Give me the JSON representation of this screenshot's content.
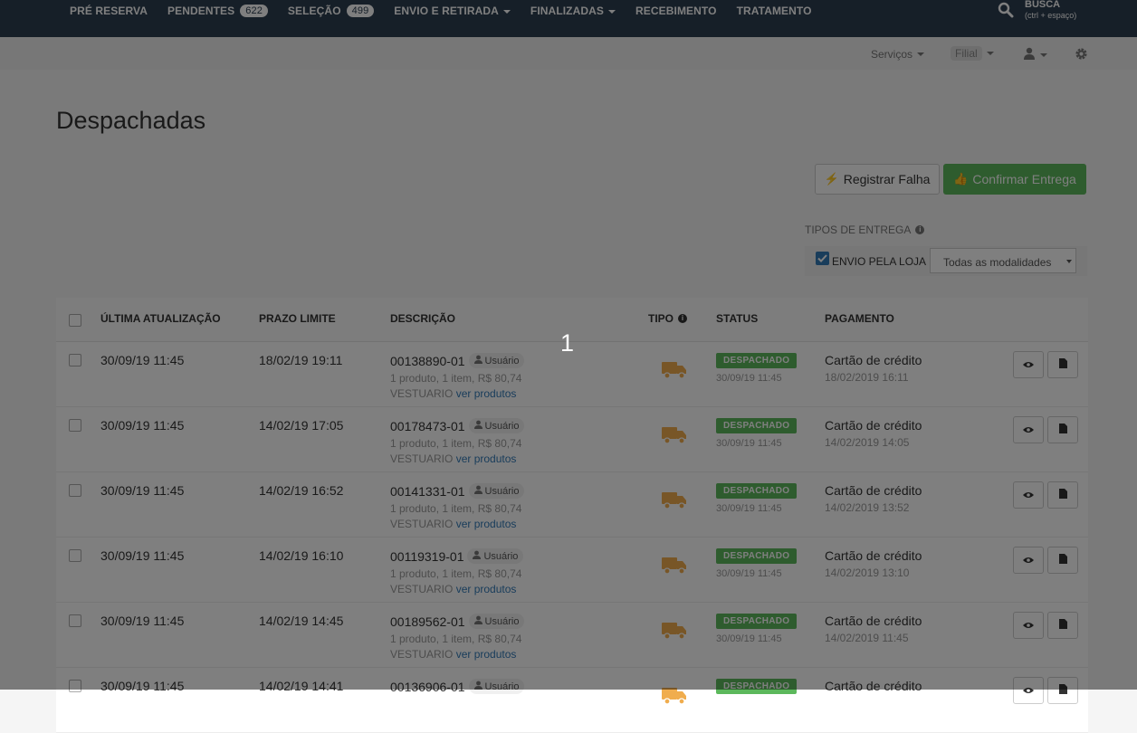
{
  "nav": {
    "items": [
      {
        "label": "PRÉ RESERVA"
      },
      {
        "label": "PENDENTES",
        "badge": "622"
      },
      {
        "label": "SELEÇÃO",
        "badge": "499"
      },
      {
        "label": "ENVIO E RETIRADA",
        "dropdown": true
      },
      {
        "label": "FINALIZADAS",
        "dropdown": true
      },
      {
        "label": "RECEBIMENTO"
      },
      {
        "label": "TRATAMENTO"
      }
    ],
    "search_label": "BUSCA",
    "search_hint": "(ctrl + espaço)"
  },
  "subbar": {
    "services_label": "Serviços",
    "filial_label": "Filial"
  },
  "page": {
    "title": "Despachadas"
  },
  "actions": {
    "register_failure": "Registrar Falha",
    "confirm_delivery": "Confirmar Entrega"
  },
  "delivery_types": {
    "label": "TIPOS DE ENTREGA",
    "checkbox_label": "ENVIO PELA LOJA",
    "select_value": "Todas as modalidades"
  },
  "table": {
    "headers": {
      "last_update": "ÚLTIMA ATUALIZAÇÃO",
      "deadline": "PRAZO LIMITE",
      "description": "DESCRIÇÃO",
      "type": "TIPO",
      "status": "STATUS",
      "payment": "PAGAMENTO"
    },
    "rows": [
      {
        "last_update": "30/09/19 11:45",
        "deadline": "18/02/19 19:11",
        "order": "00138890-01",
        "user": "Usuário",
        "summary": "1 produto, 1 item, R$ 80,74",
        "category": "VESTUARIO",
        "link": "ver produtos",
        "status": "DESPACHADO",
        "status_date": "30/09/19 11:45",
        "payment": "Cartão de crédito",
        "payment_date": "18/02/2019 16:11"
      },
      {
        "last_update": "30/09/19 11:45",
        "deadline": "14/02/19 17:05",
        "order": "00178473-01",
        "user": "Usuário",
        "summary": "1 produto, 1 item, R$ 80,74",
        "category": "VESTUARIO",
        "link": "ver produtos",
        "status": "DESPACHADO",
        "status_date": "30/09/19 11:45",
        "payment": "Cartão de crédito",
        "payment_date": "14/02/2019 14:05"
      },
      {
        "last_update": "30/09/19 11:45",
        "deadline": "14/02/19 16:52",
        "order": "00141331-01",
        "user": "Usuário",
        "summary": "1 produto, 1 item, R$ 80,74",
        "category": "VESTUARIO",
        "link": "ver produtos",
        "status": "DESPACHADO",
        "status_date": "30/09/19 11:45",
        "payment": "Cartão de crédito",
        "payment_date": "14/02/2019 13:52"
      },
      {
        "last_update": "30/09/19 11:45",
        "deadline": "14/02/19 16:10",
        "order": "00119319-01",
        "user": "Usuário",
        "summary": "1 produto, 1 item, R$ 80,74",
        "category": "VESTUARIO",
        "link": "ver produtos",
        "status": "DESPACHADO",
        "status_date": "30/09/19 11:45",
        "payment": "Cartão de crédito",
        "payment_date": "14/02/2019 13:10"
      },
      {
        "last_update": "30/09/19 11:45",
        "deadline": "14/02/19 14:45",
        "order": "00189562-01",
        "user": "Usuário",
        "summary": "1 produto, 1 item, R$ 80,74",
        "category": "VESTUARIO",
        "link": "ver produtos",
        "status": "DESPACHADO",
        "status_date": "30/09/19 11:45",
        "payment": "Cartão de crédito",
        "payment_date": "14/02/2019 11:45"
      },
      {
        "last_update": "30/09/19 11:45",
        "deadline": "14/02/19 14:41",
        "order": "00136906-01",
        "user": "Usuário",
        "summary": "",
        "category": "",
        "link": "",
        "status": "DESPACHADO",
        "status_date": "",
        "payment": "Cartão de crédito",
        "payment_date": ""
      }
    ]
  },
  "overlay": {
    "step_number": "1"
  },
  "colors": {
    "navbar": "#2c3e50",
    "success": "#5cb85c",
    "link": "#337ab7",
    "truck": "#f0ad4e"
  }
}
